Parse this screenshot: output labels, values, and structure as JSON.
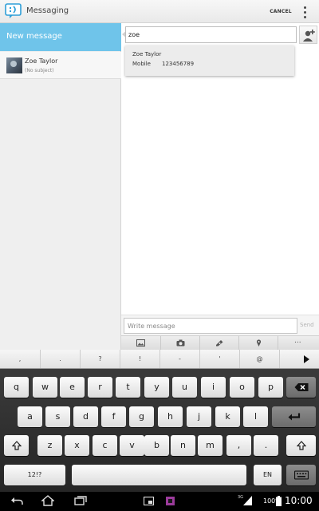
{
  "app": {
    "title": "Messaging",
    "cancel_label": "CANCEL"
  },
  "sidebar": {
    "new_message_label": "New message",
    "conversations": [
      {
        "name": "Zoe Taylor",
        "subject": "(No subject)"
      }
    ]
  },
  "recipient": {
    "value": "zoe"
  },
  "suggestion": {
    "name": "Zoe Taylor",
    "type": "Mobile",
    "number": "123456789"
  },
  "compose": {
    "placeholder": "Write message",
    "send_label": "Send"
  },
  "attach_bar": {
    "more_label": "..."
  },
  "keyboard": {
    "suggestion_keys": [
      ",",
      ".",
      "?",
      "!",
      "-",
      "'",
      "@"
    ],
    "row1": [
      "q",
      "w",
      "e",
      "r",
      "t",
      "y",
      "u",
      "i",
      "o",
      "p"
    ],
    "row2": [
      "a",
      "s",
      "d",
      "f",
      "g",
      "h",
      "j",
      "k",
      "l"
    ],
    "row3": [
      "z",
      "x",
      "c",
      "v",
      "b",
      "n",
      "m",
      ",",
      "."
    ],
    "symbols_label": "12!?",
    "language_label": "EN"
  },
  "status": {
    "network": "3G",
    "battery": "100%",
    "time": "10:00"
  },
  "colors": {
    "accent": "#6fc4ea",
    "keyboard_bg": "#2e2e2e",
    "status_bar": "#000000"
  }
}
